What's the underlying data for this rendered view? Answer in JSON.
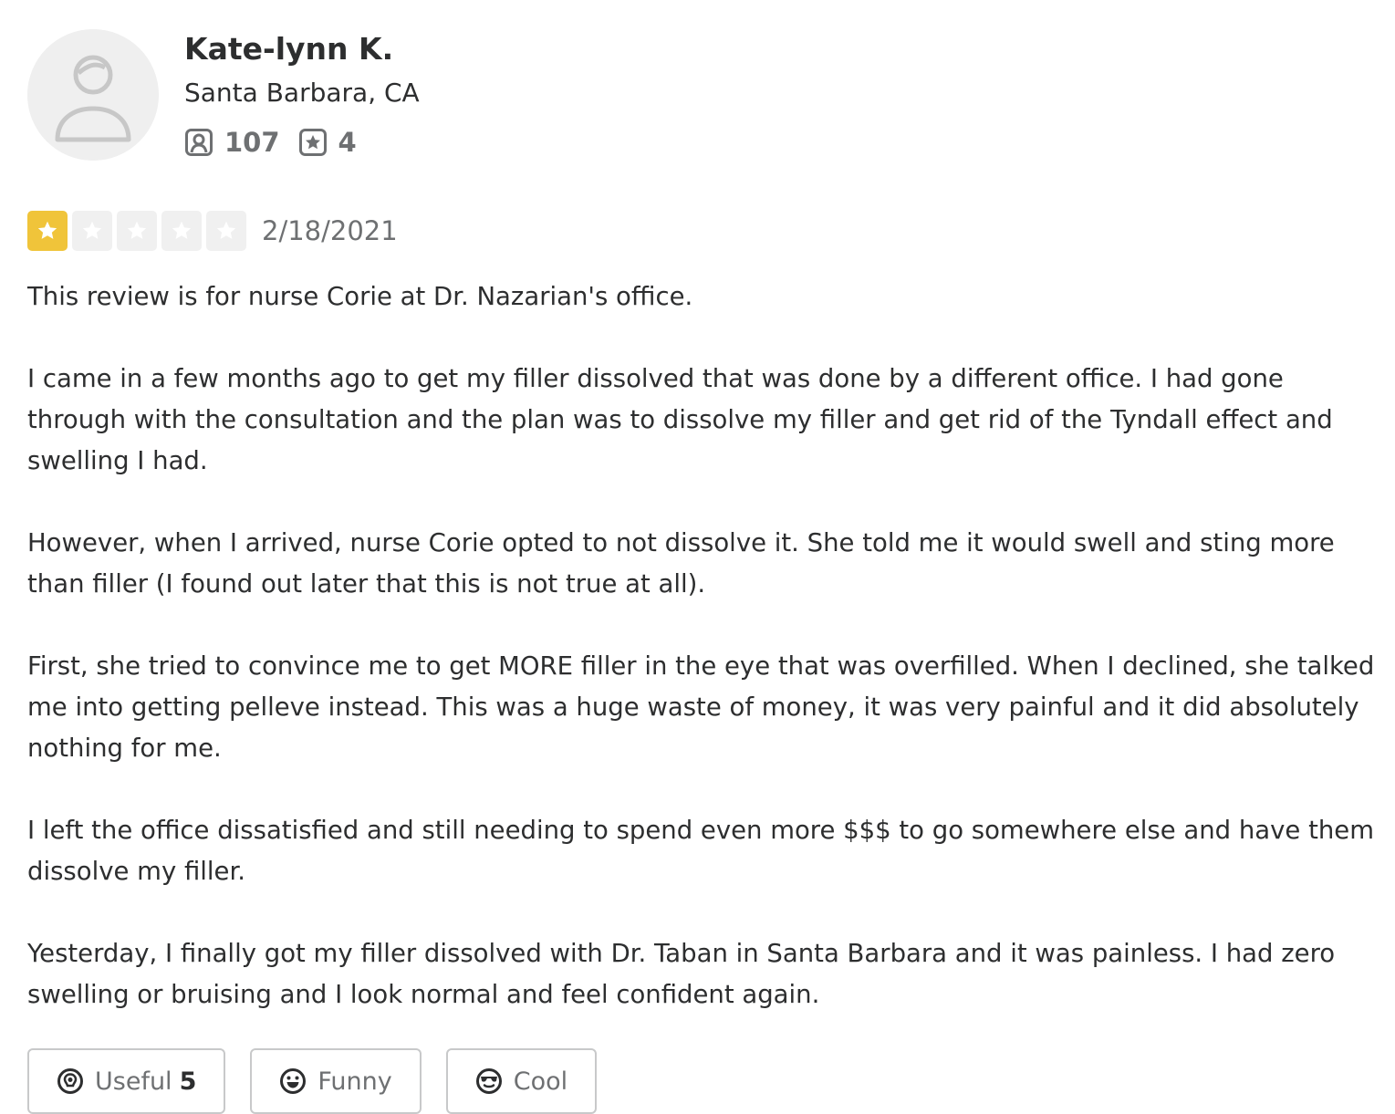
{
  "user": {
    "name": "Kate-lynn K.",
    "location": "Santa Barbara, CA",
    "review_count": "107",
    "photo_count": "4"
  },
  "review": {
    "rating": 1,
    "max_rating": 5,
    "date": "2/18/2021",
    "paragraphs": [
      "This review is for nurse Corie at Dr. Nazarian's office.",
      "I came in a few months ago to get my filler dissolved that was done by a different office. I had gone through with the consultation and the plan was to dissolve my filler and get rid of the Tyndall effect and swelling I had.",
      "However, when I arrived, nurse Corie opted to not dissolve it. She told me it would swell and sting more than filler (I found out later that this is not true at all).",
      "First, she tried to convince me to get MORE filler in the eye that was overfilled. When I declined, she talked me into getting pelleve instead. This was a huge waste of money, it was very painful and it did absolutely nothing for me.",
      "I left the office dissatisfied and still needing to spend even more $$$ to go somewhere else and have them dissolve my filler.",
      "Yesterday, I finally got my filler dissolved with Dr. Taban in Santa Barbara and it was painless. I had zero swelling or bruising and I look normal and feel confident again."
    ]
  },
  "reactions": {
    "useful_label": "Useful",
    "useful_count": "5",
    "funny_label": "Funny",
    "cool_label": "Cool"
  },
  "colors": {
    "star_filled": "#f0c43a",
    "star_empty": "#f0f0f0",
    "text": "#2d2e2f",
    "muted": "#6e7072"
  },
  "icons": {
    "avatar": "default-user-avatar",
    "reviews": "review-bubble-icon",
    "photos": "star-badge-icon",
    "useful": "lightbulb-icon",
    "funny": "smiley-icon",
    "cool": "sunglasses-icon"
  }
}
